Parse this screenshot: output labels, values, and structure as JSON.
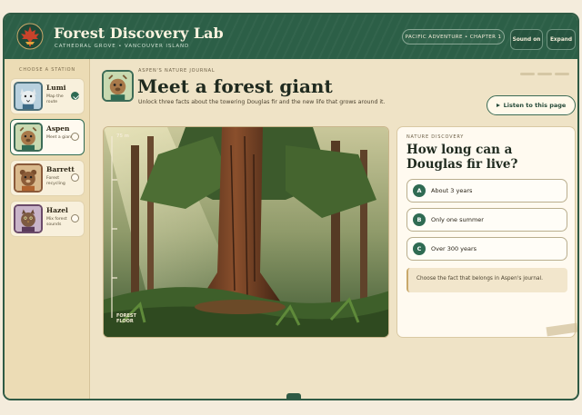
{
  "header": {
    "title": "Forest Discovery Lab",
    "subtitle": "CATHEDRAL GROVE • VANCOUVER ISLAND",
    "chapter": "PACIFIC ADVENTURE • CHAPTER 1",
    "sound_label": "Sound on",
    "expand_label": "Expand"
  },
  "sidebar": {
    "title": "CHOOSE A STATION",
    "stations": [
      {
        "name": "Lumi",
        "desc": "Map the route",
        "state": "done"
      },
      {
        "name": "Aspen",
        "desc": "Meet a giant",
        "state": "active"
      },
      {
        "name": "Barrett",
        "desc": "Forest recycling",
        "state": "todo"
      },
      {
        "name": "Hazel",
        "desc": "Mix forest sounds",
        "state": "todo"
      }
    ]
  },
  "main": {
    "journal_label": "ASPEN'S NATURE JOURNAL",
    "title": "Meet a forest giant",
    "intro": "Unlock three facts about the towering Douglas fir and the new life that grows around it.",
    "listen_label": "Listen to this page",
    "ruler_top": "75 m",
    "ruler_bottom": "FOREST FLOOR"
  },
  "quiz": {
    "label": "NATURE DISCOVERY",
    "question": "How long can a Douglas fir live?",
    "options": [
      {
        "letter": "A",
        "text": "About 3 years"
      },
      {
        "letter": "B",
        "text": "Only one summer"
      },
      {
        "letter": "C",
        "text": "Over 300 years"
      }
    ],
    "hint": "Choose the fact that belongs in Aspen's journal."
  },
  "colors": {
    "header_green": "#2c5f47",
    "accent_green": "#2f6b53",
    "parchment": "#efe3c6"
  }
}
